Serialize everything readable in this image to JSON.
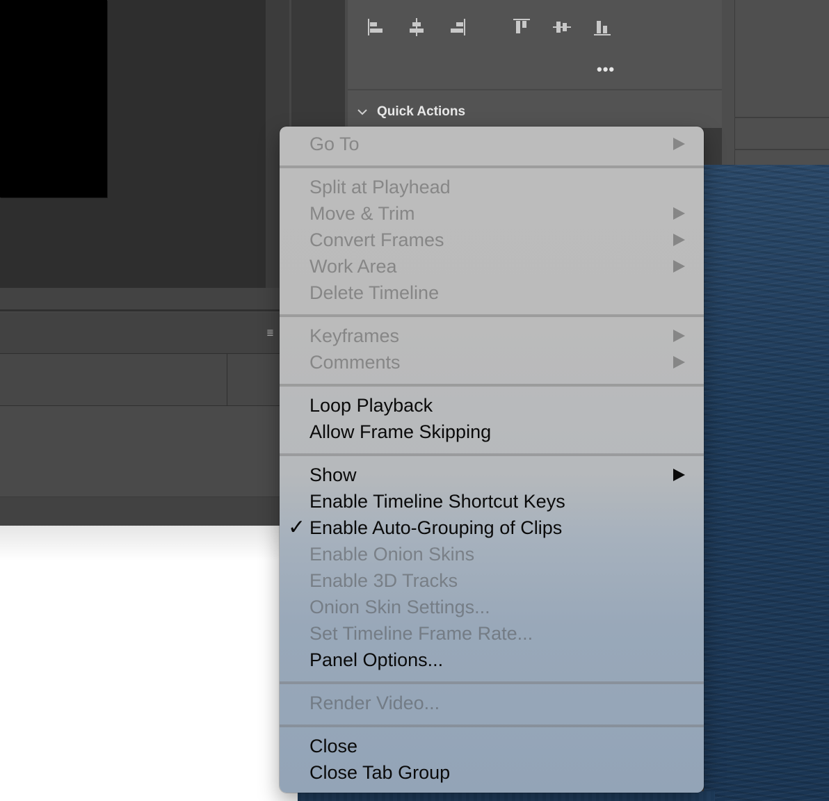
{
  "panel": {
    "quick_actions_title": "Quick Actions",
    "more_label": "•••",
    "panel_menu_icon": "≣"
  },
  "icons": {
    "align": [
      "align-left-edges-icon",
      "align-horizontal-centers-icon",
      "align-right-edges-icon",
      "align-top-edges-icon",
      "align-vertical-centers-icon",
      "align-bottom-edges-icon"
    ]
  },
  "colors": {
    "panel_bg": "#535353",
    "menu_bg_top": "#bcbcbc",
    "menu_bg_bottom": "#93a4b7",
    "enabled_text": "#0a0a0a"
  },
  "menu": {
    "items": [
      {
        "label": "Go To",
        "enabled": false,
        "submenu": true
      },
      {
        "label": "Split at Playhead",
        "enabled": false,
        "submenu": false
      },
      {
        "label": "Move & Trim",
        "enabled": false,
        "submenu": true
      },
      {
        "label": "Convert Frames",
        "enabled": false,
        "submenu": true
      },
      {
        "label": "Work Area",
        "enabled": false,
        "submenu": true
      },
      {
        "label": "Delete Timeline",
        "enabled": false,
        "submenu": false
      },
      {
        "label": "Keyframes",
        "enabled": false,
        "submenu": true
      },
      {
        "label": "Comments",
        "enabled": false,
        "submenu": true
      },
      {
        "label": "Loop Playback",
        "enabled": true,
        "submenu": false
      },
      {
        "label": "Allow Frame Skipping",
        "enabled": true,
        "submenu": false
      },
      {
        "label": "Show",
        "enabled": true,
        "submenu": true
      },
      {
        "label": "Enable Timeline Shortcut Keys",
        "enabled": true,
        "submenu": false
      },
      {
        "label": "Enable Auto-Grouping of Clips",
        "enabled": true,
        "submenu": false,
        "checked": true,
        "check_mark": "✓"
      },
      {
        "label": "Enable Onion Skins",
        "enabled": false,
        "submenu": false
      },
      {
        "label": "Enable 3D Tracks",
        "enabled": false,
        "submenu": false
      },
      {
        "label": "Onion Skin Settings...",
        "enabled": false,
        "submenu": false
      },
      {
        "label": "Set Timeline Frame Rate...",
        "enabled": false,
        "submenu": false
      },
      {
        "label": "Panel Options...",
        "enabled": true,
        "submenu": false
      },
      {
        "label": "Render Video...",
        "enabled": false,
        "submenu": false
      },
      {
        "label": "Close",
        "enabled": true,
        "submenu": false
      },
      {
        "label": "Close Tab Group",
        "enabled": true,
        "submenu": false
      }
    ]
  }
}
